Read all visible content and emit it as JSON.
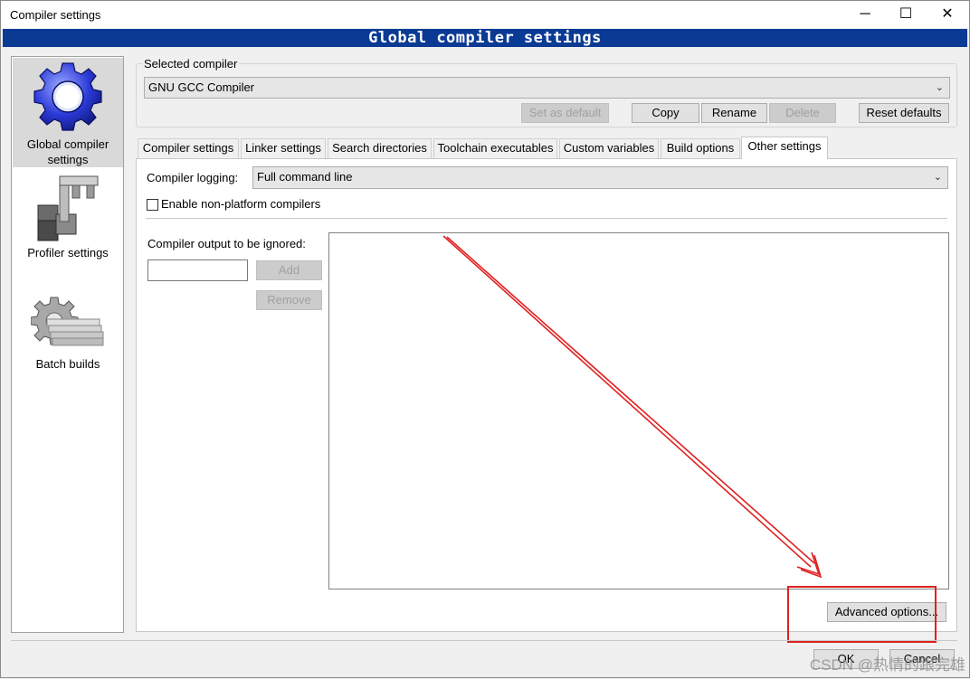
{
  "window": {
    "title": "Compiler settings",
    "minimize_glyph": "─",
    "maximize_glyph": "☐",
    "close_glyph": "✕"
  },
  "header": {
    "title": "Global compiler settings"
  },
  "sidebar": {
    "items": [
      {
        "label_line1": "Global compiler",
        "label_line2": "settings",
        "icon": "gear-icon",
        "selected": true
      },
      {
        "label": "Profiler settings",
        "icon": "profiler-icon",
        "selected": false
      },
      {
        "label": "Batch builds",
        "icon": "batch-builds-icon",
        "selected": false
      }
    ]
  },
  "selected_compiler": {
    "legend": "Selected compiler",
    "value": "GNU GCC Compiler",
    "buttons": {
      "set_default": "Set as default",
      "copy": "Copy",
      "rename": "Rename",
      "delete": "Delete",
      "reset": "Reset defaults"
    }
  },
  "tabs": [
    {
      "label": "Compiler settings"
    },
    {
      "label": "Linker settings"
    },
    {
      "label": "Search directories"
    },
    {
      "label": "Toolchain executables"
    },
    {
      "label": "Custom variables"
    },
    {
      "label": "Build options"
    },
    {
      "label": "Other settings",
      "active": true
    }
  ],
  "other_settings": {
    "logging_label": "Compiler logging:",
    "logging_value": "Full command line",
    "nonplatform_label": "Enable non-platform compilers",
    "nonplatform_checked": false,
    "ignored_label": "Compiler output to be ignored:",
    "ignored_input_value": "",
    "add_button": "Add",
    "remove_button": "Remove",
    "advanced_button": "Advanced options..."
  },
  "footer": {
    "ok": "OK",
    "cancel": "Cancel"
  },
  "watermark": "CSDN @热情的跟完雄",
  "colors": {
    "header_band": "#0a3a94",
    "annotation_red": "#e02020"
  }
}
